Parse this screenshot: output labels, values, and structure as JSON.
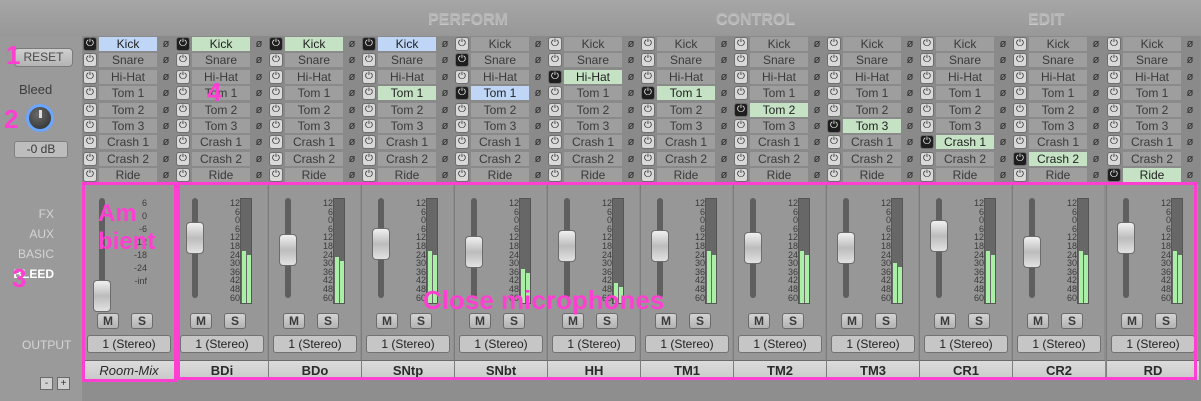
{
  "header": {
    "perform": "PERFORM",
    "control": "CONTROL",
    "edit": "EDIT"
  },
  "left": {
    "reset": "RESET",
    "bleed_label": "Bleed",
    "bleed_db": "-0 dB",
    "tabs": [
      "FX",
      "AUX",
      "BASIC",
      "BLEED"
    ],
    "output_label": "OUTPUT",
    "minus": "-",
    "plus": "+"
  },
  "grid": {
    "rows": [
      "Kick",
      "Snare",
      "Hi-Hat",
      "Tom 1",
      "Tom 2",
      "Tom 3",
      "Crash 1",
      "Crash 2",
      "Ride"
    ],
    "phase_symbol": "ø",
    "power_symbol": "⏻"
  },
  "strips": [
    {
      "name": "Room-Mix",
      "output": "1 (Stereo)",
      "m": "M",
      "s": "S"
    },
    {
      "name": "BDi",
      "output": "1 (Stereo)",
      "m": "M",
      "s": "S"
    },
    {
      "name": "BDo",
      "output": "1 (Stereo)",
      "m": "M",
      "s": "S"
    },
    {
      "name": "SNtp",
      "output": "1 (Stereo)",
      "m": "M",
      "s": "S"
    },
    {
      "name": "SNbt",
      "output": "1 (Stereo)",
      "m": "M",
      "s": "S"
    },
    {
      "name": "HH",
      "output": "1 (Stereo)",
      "m": "M",
      "s": "S"
    },
    {
      "name": "TM1",
      "output": "1 (Stereo)",
      "m": "M",
      "s": "S"
    },
    {
      "name": "TM2",
      "output": "1 (Stereo)",
      "m": "M",
      "s": "S"
    },
    {
      "name": "TM3",
      "output": "1 (Stereo)",
      "m": "M",
      "s": "S"
    },
    {
      "name": "CR1",
      "output": "1 (Stereo)",
      "m": "M",
      "s": "S"
    },
    {
      "name": "CR2",
      "output": "1 (Stereo)",
      "m": "M",
      "s": "S"
    },
    {
      "name": "RD",
      "output": "1 (Stereo)",
      "m": "M",
      "s": "S"
    }
  ],
  "scale": [
    "12",
    "6",
    "0",
    "6",
    "12",
    "18",
    "24",
    "30",
    "36",
    "42",
    "48",
    "60"
  ],
  "room_scale": [
    "6",
    "0",
    "-6",
    "-12",
    "-18",
    "-24",
    "-inf"
  ],
  "annotations": {
    "n1": "1",
    "n2": "2",
    "n3": "3",
    "n4": "4",
    "ambient_line1": "Am",
    "ambient_line2": "bient",
    "close": "Close microphones"
  },
  "colors": {
    "annotation": "#ff3fd2",
    "selected": "#c6e2c5",
    "meter": "#a9f0a6",
    "knob_ring": "#6aa6ff"
  }
}
